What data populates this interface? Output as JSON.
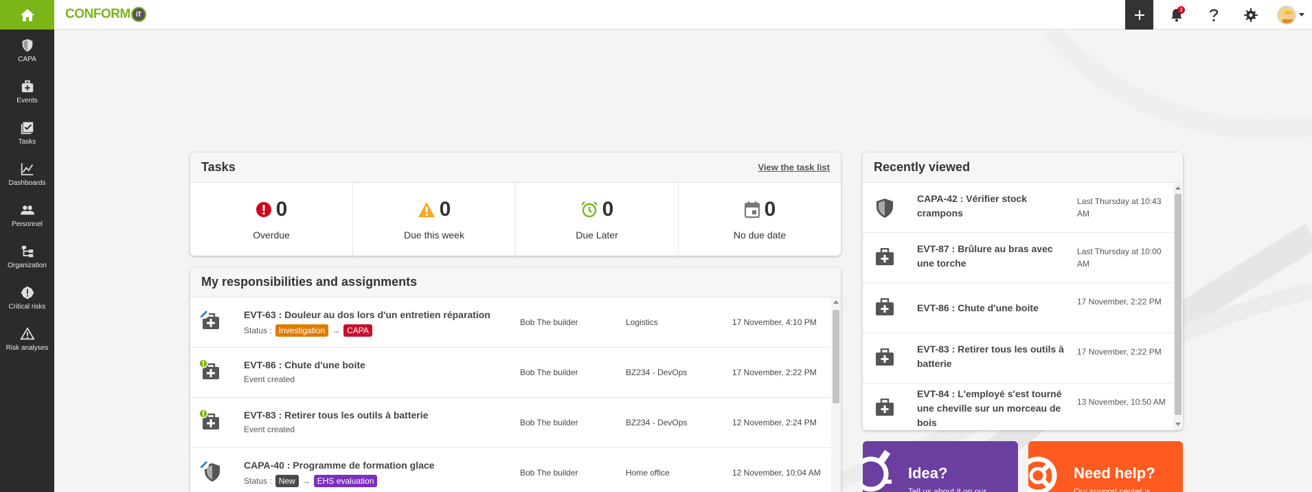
{
  "app": {
    "logo_text": "CONFORM",
    "logo_badge": "iT"
  },
  "sidebar": {
    "items": [
      {
        "label": "CAPA",
        "icon": "shield-icon"
      },
      {
        "label": "Events",
        "icon": "first-aid-kit-icon"
      },
      {
        "label": "Tasks",
        "icon": "checklist-icon"
      },
      {
        "label": "Dashboards",
        "icon": "line-chart-icon"
      },
      {
        "label": "Personnel",
        "icon": "people-icon"
      },
      {
        "label": "Organization",
        "icon": "org-chart-icon"
      },
      {
        "label": "Critical risks",
        "icon": "alert-gear-icon"
      },
      {
        "label": "Risk analyses",
        "icon": "warning-triangle-icon"
      }
    ]
  },
  "topbar": {
    "notification_count": "3"
  },
  "tasks": {
    "title": "Tasks",
    "link": "View the task list",
    "cells": [
      {
        "count": "0",
        "label": "Overdue",
        "icon": "exclamation-icon",
        "color": "#d0021b"
      },
      {
        "count": "0",
        "label": "Due this week",
        "icon": "warning-icon",
        "color": "#f5a623"
      },
      {
        "count": "0",
        "label": "Due Later",
        "icon": "alarm-clock-icon",
        "color": "#7cb518"
      },
      {
        "count": "0",
        "label": "No due date",
        "icon": "calendar-icon",
        "color": "#777777"
      }
    ]
  },
  "responsibilities": {
    "title": "My responsibilities and assignments",
    "rows": [
      {
        "title": "EVT-63 : Douleur au dos lors d'un entretien réparation",
        "status_prefix": "Status :",
        "status_from": "Investigation",
        "status_to": "CAPA",
        "owner": "Bob The builder",
        "location": "Logistics",
        "date": "17 November, 4:10 PM"
      },
      {
        "title": "EVT-86 : Chute d'une boite",
        "subtitle": "Event created",
        "owner": "Bob The builder",
        "location": "BZ234 - DevOps",
        "date": "17 November, 2:22 PM"
      },
      {
        "title": "EVT-83 : Retirer tous les outils à batterie",
        "subtitle": "Event created",
        "owner": "Bob The builder",
        "location": "BZ234 - DevOps",
        "date": "12 November, 2:24 PM"
      },
      {
        "title": "CAPA-40 : Programme de formation glace",
        "status_prefix": "Status :",
        "status_from": "New",
        "status_to": "EHS evaluation",
        "owner": "Bob The builder",
        "location": "Home office",
        "date": "12 November, 10:04 AM"
      }
    ]
  },
  "recent": {
    "title": "Recently viewed",
    "items": [
      {
        "title": "CAPA-42 : Vérifier stock crampons",
        "date": "Last Thursday at 10:43 AM",
        "icon": "shield-icon"
      },
      {
        "title": "EVT-87 : Brûlure au bras avec une torche",
        "date": "Last Thursday at 10:00 AM",
        "icon": "first-aid-kit-icon"
      },
      {
        "title": "EVT-86 : Chute d'une boite",
        "date": "17 November, 2:22 PM",
        "icon": "first-aid-kit-icon"
      },
      {
        "title": "EVT-83 : Retirer tous les outils à batterie",
        "date": "17 November, 2:22 PM",
        "icon": "first-aid-kit-icon"
      },
      {
        "title": "EVT-84 : L'employé s'est tourné une cheville sur un morceau de bois",
        "date": "13 November, 10:50 AM",
        "icon": "first-aid-kit-icon"
      }
    ]
  },
  "promos": {
    "idea": {
      "title": "Idea?",
      "subtitle": "Tell us about it on our",
      "color": "#6b3fa0"
    },
    "help": {
      "title": "Need help?",
      "subtitle": "Our support center is",
      "color": "#ff5a1f"
    }
  },
  "colors": {
    "brand_green": "#7cb518",
    "sidebar_bg": "#2b2b2b",
    "investigation": "#e07b00",
    "capa": "#c8102e",
    "new": "#4a4a4a",
    "ehs": "#7b2fbe"
  }
}
